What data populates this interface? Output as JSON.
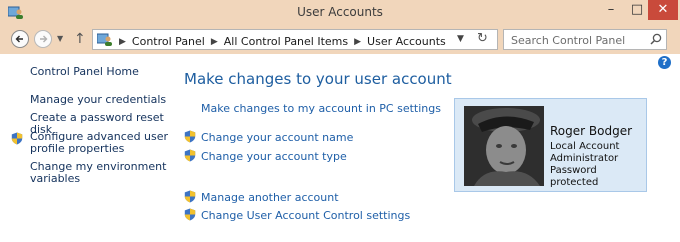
{
  "window": {
    "title": "User Accounts",
    "min_label": "–",
    "max_label": "□",
    "close_label": "✕"
  },
  "address_bar": {
    "crumbs": [
      "Control Panel",
      "All Control Panel Items",
      "User Accounts"
    ]
  },
  "search": {
    "placeholder": "Search Control Panel"
  },
  "sidebar": {
    "items": [
      {
        "label": "Control Panel Home"
      },
      {
        "label": "Manage your credentials"
      },
      {
        "label": "Create a password reset disk"
      },
      {
        "label": "Configure advanced user profile properties",
        "line1": "Configure advanced user",
        "line2": "profile properties",
        "shield": true
      },
      {
        "label": "Change my environment variables",
        "line1": "Change my environment",
        "line2": "variables"
      }
    ]
  },
  "main": {
    "title": "Make changes to your user account",
    "tasks": [
      {
        "label": "Make changes to my account in PC settings",
        "shield": false
      },
      {
        "label": "Change your account name",
        "shield": true
      },
      {
        "label": "Change your account type",
        "shield": true
      },
      {
        "label": "Manage another account",
        "shield": true
      },
      {
        "label": "Change User Account Control settings",
        "shield": true
      }
    ]
  },
  "account": {
    "name": "Roger Bodger",
    "type": "Local Account",
    "role": "Administrator",
    "status": "Password protected"
  },
  "colors": {
    "chrome": "#f1d6bb",
    "link": "#1f5fa8",
    "heading": "#1e5ea0",
    "card_bg": "#dbe9f6",
    "close_button": "#c94a3b"
  },
  "icons": {
    "app": "control-panel-users-icon",
    "shield": "uac-shield-icon",
    "search": "magnifier-icon",
    "help": "help-icon"
  }
}
